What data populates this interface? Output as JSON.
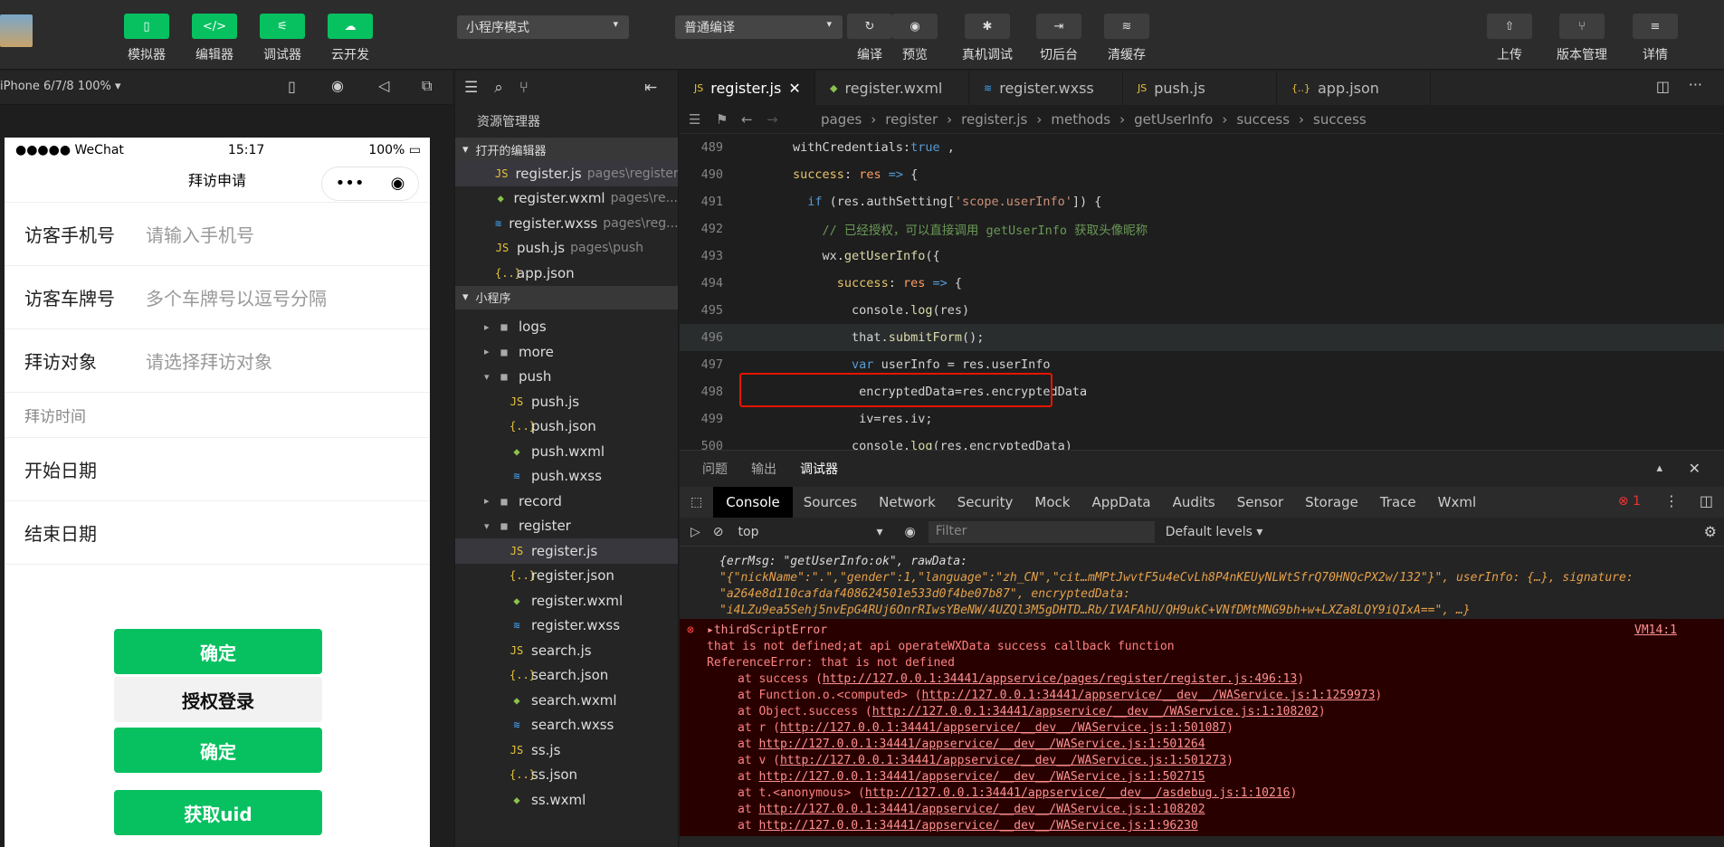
{
  "toolbar": {
    "left": [
      {
        "label": "模拟器",
        "icon": "phone-icon"
      },
      {
        "label": "编辑器",
        "icon": "code-icon"
      },
      {
        "label": "调试器",
        "icon": "debug-icon"
      },
      {
        "label": "云开发",
        "icon": "cloud-icon"
      }
    ],
    "mode_select": "小程序模式",
    "compile_select": "普通编译",
    "mid": [
      {
        "label": "编译",
        "icon": "refresh-icon"
      },
      {
        "label": "预览",
        "icon": "eye-icon"
      },
      {
        "label": "真机调试",
        "icon": "bug-icon"
      },
      {
        "label": "切后台",
        "icon": "switch-icon"
      },
      {
        "label": "清缓存",
        "icon": "layers-icon"
      }
    ],
    "right": [
      {
        "label": "上传",
        "icon": "upload-icon"
      },
      {
        "label": "版本管理",
        "icon": "branch-icon"
      },
      {
        "label": "详情",
        "icon": "menu-icon"
      }
    ]
  },
  "simulator": {
    "device": "iPhone 6/7/8 100% ▾",
    "status_left": "●●●●● WeChat",
    "time": "15:17",
    "battery": "100%",
    "title": "拜访申请",
    "rows": [
      {
        "label": "访客手机号",
        "placeholder": "请输入手机号"
      },
      {
        "label": "访客车牌号",
        "placeholder": "多个车牌号以逗号分隔"
      },
      {
        "label": "拜访对象",
        "placeholder": "请选择拜访对象"
      }
    ],
    "section": "拜访时间",
    "dates": [
      "开始日期",
      "结束日期"
    ],
    "buttons": [
      "确定",
      "授权登录",
      "确定",
      "获取uid"
    ]
  },
  "explorer": {
    "title": "资源管理器",
    "open_editors": "打开的编辑器",
    "open": [
      {
        "name": "register.js",
        "path": "pages\\register",
        "type": "js"
      },
      {
        "name": "register.wxml",
        "path": "pages\\re...",
        "type": "wx"
      },
      {
        "name": "register.wxss",
        "path": "pages\\reg...",
        "type": "ws"
      },
      {
        "name": "push.js",
        "path": "pages\\push",
        "type": "js"
      },
      {
        "name": "app.json",
        "path": "",
        "type": "jsn"
      }
    ],
    "project": "小程序",
    "tree": [
      {
        "name": "logs",
        "type": "fd",
        "indent": 1,
        "arrow": "▸"
      },
      {
        "name": "more",
        "type": "fd",
        "indent": 1,
        "arrow": "▸"
      },
      {
        "name": "push",
        "type": "fd",
        "indent": 1,
        "arrow": "▾"
      },
      {
        "name": "push.js",
        "type": "js",
        "indent": 2
      },
      {
        "name": "push.json",
        "type": "jsn",
        "indent": 2
      },
      {
        "name": "push.wxml",
        "type": "wx",
        "indent": 2
      },
      {
        "name": "push.wxss",
        "type": "ws",
        "indent": 2
      },
      {
        "name": "record",
        "type": "fd",
        "indent": 1,
        "arrow": "▸"
      },
      {
        "name": "register",
        "type": "fd",
        "indent": 1,
        "arrow": "▾"
      },
      {
        "name": "register.js",
        "type": "js",
        "indent": 2
      },
      {
        "name": "register.json",
        "type": "jsn",
        "indent": 2
      },
      {
        "name": "register.wxml",
        "type": "wx",
        "indent": 2
      },
      {
        "name": "register.wxss",
        "type": "ws",
        "indent": 2
      },
      {
        "name": "search.js",
        "type": "js",
        "indent": 2
      },
      {
        "name": "search.json",
        "type": "jsn",
        "indent": 2
      },
      {
        "name": "search.wxml",
        "type": "wx",
        "indent": 2
      },
      {
        "name": "search.wxss",
        "type": "ws",
        "indent": 2
      },
      {
        "name": "ss.js",
        "type": "js",
        "indent": 2
      },
      {
        "name": "ss.json",
        "type": "jsn",
        "indent": 2
      },
      {
        "name": "ss.wxml",
        "type": "wx",
        "indent": 2
      }
    ]
  },
  "editor": {
    "tabs": [
      {
        "name": "register.js",
        "type": "js"
      },
      {
        "name": "register.wxml",
        "type": "wx"
      },
      {
        "name": "register.wxss",
        "type": "ws"
      },
      {
        "name": "push.js",
        "type": "js"
      },
      {
        "name": "app.json",
        "type": "jsn"
      }
    ],
    "breadcrumb": [
      "pages",
      "register",
      "register.js",
      "methods",
      "getUserInfo",
      "success",
      "success"
    ],
    "lines": [
      {
        "no": "489",
        "html": "        withCredentials:<span class='k'>true</span> ,"
      },
      {
        "no": "490",
        "html": "        <span class='y'>success</span>: <span class='p'>res</span> <span class='k'>=></span> {"
      },
      {
        "no": "491",
        "html": "          <span class='k'>if</span> (res.authSetting[<span class='s'>'scope.userInfo'</span>]) {"
      },
      {
        "no": "492",
        "html": "            <span class='c'>// 已经授权，可以直接调用 getUserInfo 获取头像昵称</span>"
      },
      {
        "no": "493",
        "html": "            wx.<span class='f'>getUserInfo</span>({"
      },
      {
        "no": "494",
        "html": "              <span class='y'>success</span>: <span class='p'>res</span> <span class='k'>=></span> {"
      },
      {
        "no": "495",
        "html": "                console.<span class='f'>log</span>(res)"
      },
      {
        "no": "496",
        "html": "                that.<span class='f'>submitForm</span>();"
      },
      {
        "no": "497",
        "html": "                <span class='k'>var</span> userInfo = res.userInfo"
      },
      {
        "no": "498",
        "html": "                 encryptedData=res.encryptedData"
      },
      {
        "no": "499",
        "html": "                 iv=res.iv;"
      },
      {
        "no": "500",
        "html": "                console.<span class='f'>log</span>(res.encryptedData)"
      }
    ]
  },
  "panel": {
    "tabs": [
      "问题",
      "输出",
      "调试器"
    ],
    "devtabs": [
      "Console",
      "Sources",
      "Network",
      "Security",
      "Mock",
      "AppData",
      "Audits",
      "Sensor",
      "Storage",
      "Trace",
      "Wxml"
    ],
    "context": "top",
    "filter": "Filter",
    "levels": "Default levels ▾",
    "error_count": "1",
    "info": [
      "{errMsg: \"getUserInfo:ok\", rawData:",
      "\"{\"nickName\":\".\",\"gender\":1,\"language\":\"zh_CN\",\"cit…mMPtJwvtF5u4eCvLh8P4nKEUyNLWtSfrQ70HNQcPX2w/132\"}\", userInfo: {…}, signature:",
      "\"a264e8d110cafdaf408624501e533d0f4be07b87\", encryptedData:",
      "\"i4LZu9ea5Sehj5nvEpG4RUj6OnrRIwsYBeNW/4UZQl3M5gDHTD…Rb/IVAFAhU/QH9ukC+VNfDMtMNG9bh+w+LXZa8LQY9iQIxA==\", …}"
    ],
    "error": {
      "title": "▸thirdScriptError",
      "vm": "VM14:1",
      "l1": "that is not defined;at api operateWXData success callback function",
      "l2": "ReferenceError: that is not defined",
      "stack": [
        {
          "pre": "at success (",
          "url": "http://127.0.0.1:34441/appservice/pages/register/register.js:496:13",
          "post": ")"
        },
        {
          "pre": "at Function.o.<computed> (",
          "url": "http://127.0.0.1:34441/appservice/__dev__/WAService.js:1:1259973",
          "post": ")"
        },
        {
          "pre": "at Object.success (",
          "url": "http://127.0.0.1:34441/appservice/__dev__/WAService.js:1:108202",
          "post": ")"
        },
        {
          "pre": "at r (",
          "url": "http://127.0.0.1:34441/appservice/__dev__/WAService.js:1:501087",
          "post": ")"
        },
        {
          "pre": "at ",
          "url": "http://127.0.0.1:34441/appservice/__dev__/WAService.js:1:501264",
          "post": ""
        },
        {
          "pre": "at v (",
          "url": "http://127.0.0.1:34441/appservice/__dev__/WAService.js:1:501273",
          "post": ")"
        },
        {
          "pre": "at ",
          "url": "http://127.0.0.1:34441/appservice/__dev__/WAService.js:1:502715",
          "post": ""
        },
        {
          "pre": "at t.<anonymous> (",
          "url": "http://127.0.0.1:34441/appservice/__dev__/asdebug.js:1:10216",
          "post": ")"
        },
        {
          "pre": "at ",
          "url": "http://127.0.0.1:34441/appservice/__dev__/WAService.js:1:108202",
          "post": ""
        },
        {
          "pre": "at ",
          "url": "http://127.0.0.1:34441/appservice/__dev__/WAService.js:1:96230",
          "post": ""
        }
      ]
    }
  }
}
